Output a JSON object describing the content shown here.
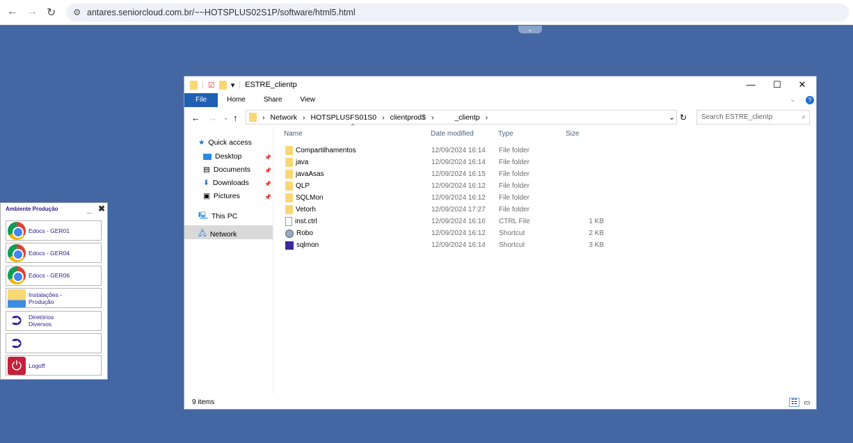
{
  "browser": {
    "url": "antares.seniorcloud.com.br/~~HOTSPLUS02S1P/software/html5.html"
  },
  "explorer": {
    "title": "ESTRE_clientp",
    "ribbon_tabs": [
      "File",
      "Home",
      "Share",
      "View"
    ],
    "breadcrumbs": [
      "Network",
      "HOTSPLUSFS01S0",
      "clientprod$",
      "_clientp"
    ],
    "search_placeholder": "Search ESTRE_clientp",
    "nav": {
      "quick_access": "Quick access",
      "desktop": "Desktop",
      "documents": "Documents",
      "downloads": "Downloads",
      "pictures": "Pictures",
      "this_pc": "This PC",
      "network": "Network"
    },
    "columns": {
      "name": "Name",
      "date": "Date modified",
      "type": "Type",
      "size": "Size"
    },
    "files": [
      {
        "name": "Compartilhamentos",
        "date": "12/09/2024 16:14",
        "type": "File folder",
        "size": "",
        "icon": "folder"
      },
      {
        "name": "java",
        "date": "12/09/2024 16:14",
        "type": "File folder",
        "size": "",
        "icon": "folder"
      },
      {
        "name": "javaAsas",
        "date": "12/09/2024 16:15",
        "type": "File folder",
        "size": "",
        "icon": "folder"
      },
      {
        "name": "QLP",
        "date": "12/09/2024 16:12",
        "type": "File folder",
        "size": "",
        "icon": "folder"
      },
      {
        "name": "SQLMon",
        "date": "12/09/2024 16:12",
        "type": "File folder",
        "size": "",
        "icon": "folder"
      },
      {
        "name": "Vetorh",
        "date": "12/09/2024 17:27",
        "type": "File folder",
        "size": "",
        "icon": "folder"
      },
      {
        "name": "inst.ctrl",
        "date": "12/09/2024 16:16",
        "type": "CTRL File",
        "size": "1 KB",
        "icon": "file"
      },
      {
        "name": "Robo",
        "date": "12/09/2024 16:12",
        "type": "Shortcut",
        "size": "2 KB",
        "icon": "robo"
      },
      {
        "name": "sqlmon",
        "date": "12/09/2024 16:14",
        "type": "Shortcut",
        "size": "3 KB",
        "icon": "sqlmon"
      }
    ],
    "status": "9 items"
  },
  "panel": {
    "title": "Ambiente Produção",
    "buttons": [
      {
        "label": "Edocs - GER01",
        "icon": "chrome"
      },
      {
        "label": "Edocs - GER04",
        "icon": "chrome"
      },
      {
        "label": "Edocs - GER06",
        "icon": "chrome"
      },
      {
        "label": "Instalações - Produção",
        "icon": "explorer"
      },
      {
        "label": "Diretórios Diversos",
        "icon": "folder-arrow"
      },
      {
        "label": "",
        "icon": "folder-arrow"
      },
      {
        "label": "Logoff",
        "icon": "power"
      }
    ]
  }
}
